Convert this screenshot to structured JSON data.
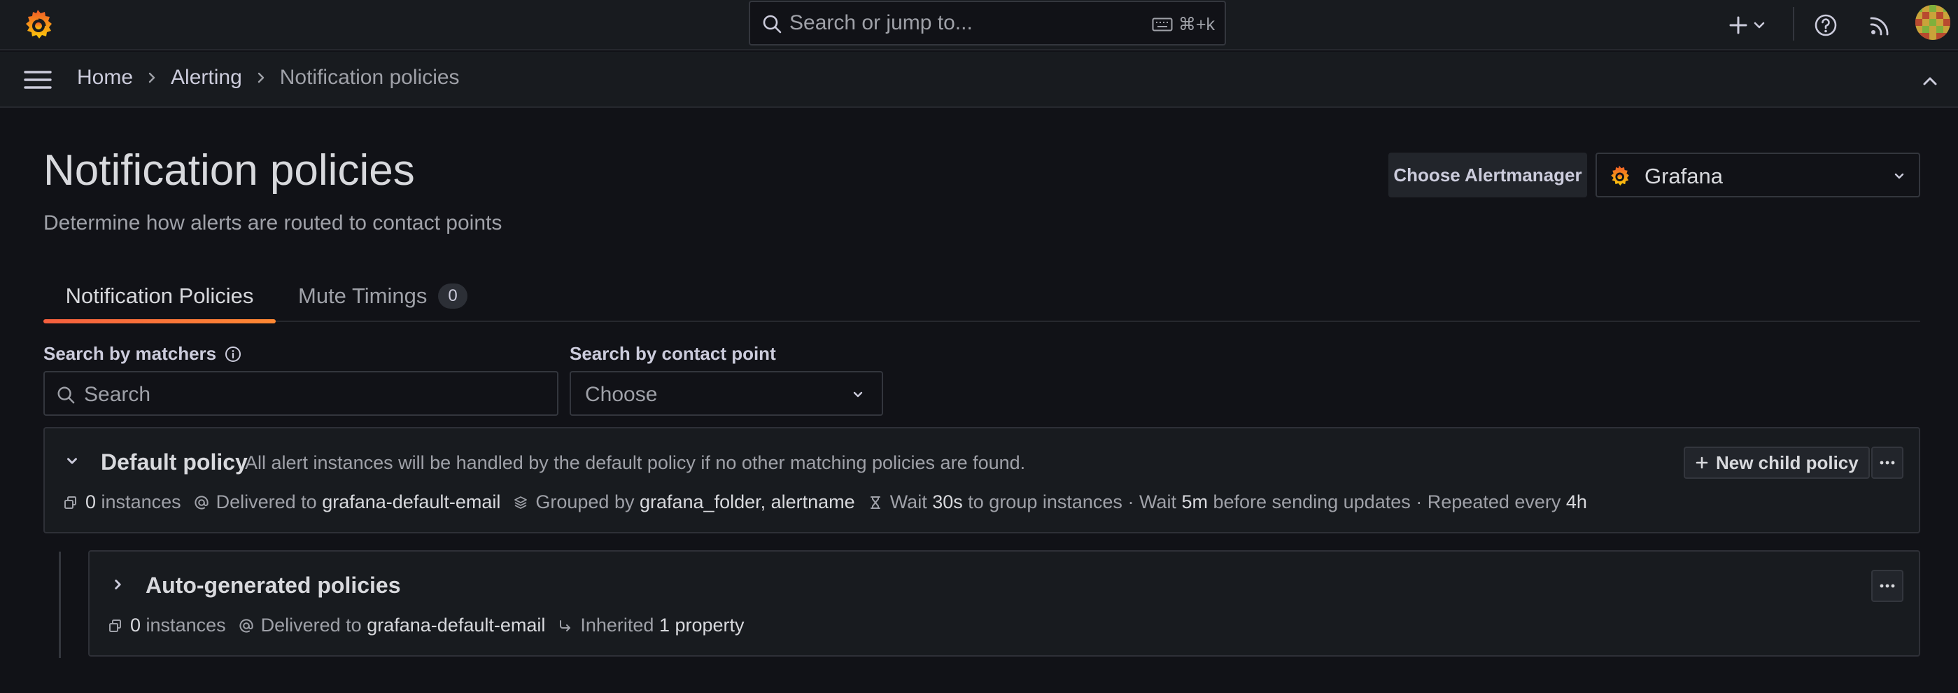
{
  "topbar": {
    "search_placeholder": "Search or jump to...",
    "search_shortcut": "⌘+k"
  },
  "breadcrumb": {
    "items": [
      "Home",
      "Alerting"
    ],
    "current": "Notification policies"
  },
  "page": {
    "title": "Notification policies",
    "subtitle": "Determine how alerts are routed to contact points"
  },
  "alertmanager": {
    "label": "Choose Alertmanager",
    "selected": "Grafana"
  },
  "tabs": [
    {
      "label": "Notification Policies",
      "active": true
    },
    {
      "label": "Mute Timings",
      "count": "0",
      "active": false
    }
  ],
  "filters": {
    "matchers_label": "Search by matchers",
    "matchers_placeholder": "Search",
    "contact_label": "Search by contact point",
    "contact_placeholder": "Choose"
  },
  "default_policy": {
    "name": "Default policy",
    "description": "All alert instances will be handled by the default policy if no other matching policies are found.",
    "new_child_label": "New child policy",
    "instances_count": "0",
    "instances_label": "instances",
    "delivered_label": "Delivered to",
    "contact_point": "grafana-default-email",
    "grouped_label": "Grouped by",
    "grouped_value": "grafana_folder, alertname",
    "wait_label": "Wait",
    "group_wait": "30s",
    "group_wait_suffix": "to group instances",
    "dot": "·",
    "wait2_label": "Wait",
    "group_interval": "5m",
    "group_interval_suffix": "before sending updates",
    "repeat_label": "Repeated every",
    "repeat_interval": "4h"
  },
  "auto_policy": {
    "name": "Auto-generated policies",
    "instances_count": "0",
    "instances_label": "instances",
    "delivered_label": "Delivered to",
    "contact_point": "grafana-default-email",
    "inherited_label": "Inherited",
    "inherited_value": "1 property"
  },
  "colors": {
    "background": "#111217",
    "panel": "#181b1f",
    "accent_orange": "#f55f3e",
    "text_primary": "#d8d9dd",
    "text_secondary": "#9fa1a8"
  }
}
